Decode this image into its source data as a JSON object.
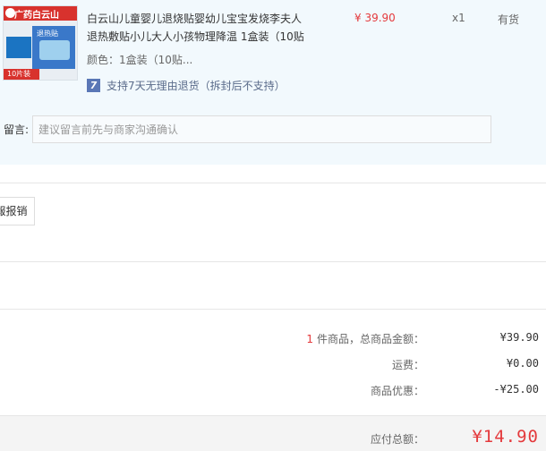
{
  "product": {
    "image_badge": "广药白云山",
    "image_box_text": "退热贴",
    "image_count": "10片装",
    "title": "白云山儿童婴儿退烧贴婴幼儿宝宝发烧李夫人退热敷贴小儿大人小孩物理降温 1盒装（10贴",
    "price": "¥ 39.90",
    "quantity": "x1",
    "stock": "有货",
    "spec": "颜色：1盒装（10贴...",
    "return_icon": "7",
    "return_policy": "支持7天无理由退货（拆封后不支持）"
  },
  "remark": {
    "label": "留言:",
    "placeholder": "建议留言前先与商家沟通确认",
    "value": ""
  },
  "invoice": {
    "button_label": "報报销"
  },
  "summary": {
    "count": "1",
    "items_label": "件商品，总商品金额：",
    "items_total": "¥39.90",
    "shipping_label": "运费：",
    "shipping": "¥0.00",
    "discount_label": "商品优惠：",
    "discount": "-¥25.00",
    "payable_label": "应付总额：",
    "payable": "¥14.90"
  },
  "colors": {
    "accent_red": "#e4393c",
    "item_bg": "#f2f9fd",
    "return_blue": "#5a77b6"
  }
}
